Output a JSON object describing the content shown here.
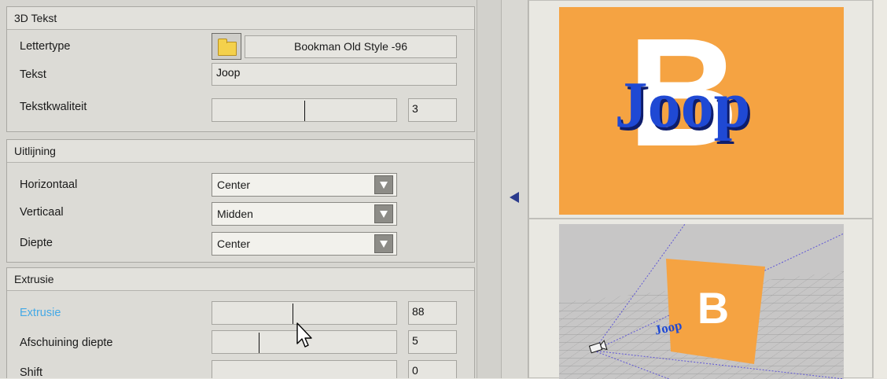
{
  "sections": {
    "tekst": {
      "title": "3D Tekst",
      "font_label": "Lettertype",
      "font_value": "Bookman Old Style -96",
      "text_label": "Tekst",
      "text_value": "Joop",
      "quality_label": "Tekstkwaliteit",
      "quality_value": "3",
      "quality_fraction": 0.5
    },
    "uitlijning": {
      "title": "Uitlijning",
      "horizontal_label": "Horizontaal",
      "horizontal_value": "Center",
      "vertical_label": "Verticaal",
      "vertical_value": "Midden",
      "depth_label": "Diepte",
      "depth_value": "Center"
    },
    "extrusie": {
      "title": "Extrusie",
      "extrusion_label": "Extrusie",
      "extrusion_value": "88",
      "bevel_label": "Afschuining diepte",
      "bevel_value": "5",
      "shift_label": "Shift",
      "shift_value": "0"
    }
  },
  "preview": {
    "text": "Joop",
    "letter": "B",
    "background_color": "#f5a342",
    "text_color": "#1f49d4"
  },
  "icons": {
    "font_browse": "folder-icon",
    "collapse": "triangle-left-icon",
    "dropdown": "chevron-down-icon",
    "camera": "camera-icon",
    "cursor": "mouse-pointer-icon"
  }
}
